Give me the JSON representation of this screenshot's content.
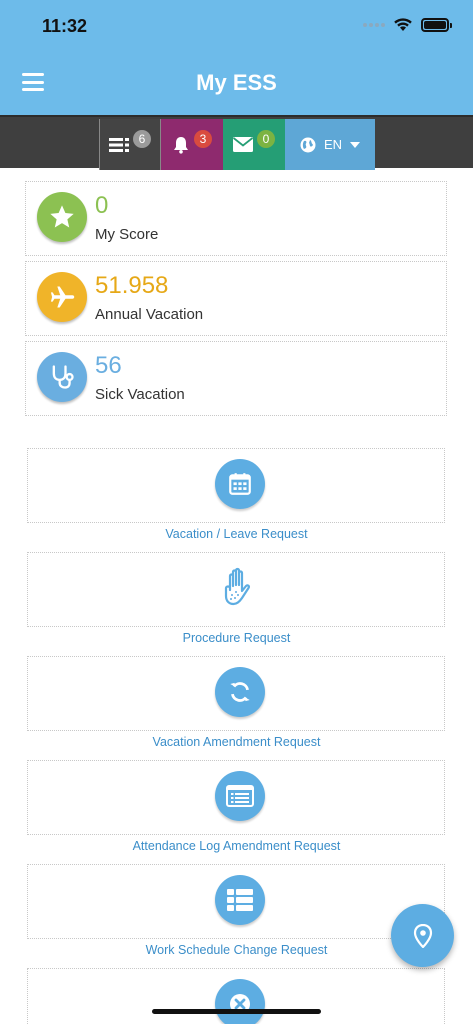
{
  "status_bar": {
    "time": "11:32"
  },
  "header": {
    "title": "My ESS"
  },
  "toolbar": {
    "tasks_count": "6",
    "notifications_count": "3",
    "messages_count": "0",
    "language": "EN"
  },
  "stats": [
    {
      "value": "0",
      "label": "My Score",
      "icon": "star-icon"
    },
    {
      "value": "51.958",
      "label": "Annual Vacation",
      "icon": "airplane-icon"
    },
    {
      "value": "56",
      "label": "Sick Vacation",
      "icon": "stethoscope-icon"
    }
  ],
  "requests": [
    {
      "label": "Vacation / Leave Request",
      "icon": "calendar-icon"
    },
    {
      "label": "Procedure Request",
      "icon": "hand-icon"
    },
    {
      "label": "Vacation Amendment Request",
      "icon": "refresh-icon"
    },
    {
      "label": "Attendance Log Amendment Request",
      "icon": "list-card-icon"
    },
    {
      "label": "Work Schedule Change Request",
      "icon": "table-list-icon"
    },
    {
      "label": "",
      "icon": "cancel-icon"
    }
  ],
  "colors": {
    "header": "#6dbbea",
    "accent": "#5dade2",
    "score": "#8cc152",
    "annual": "#f0b429",
    "sick": "#6aaee0",
    "link": "#3b8ec9"
  }
}
